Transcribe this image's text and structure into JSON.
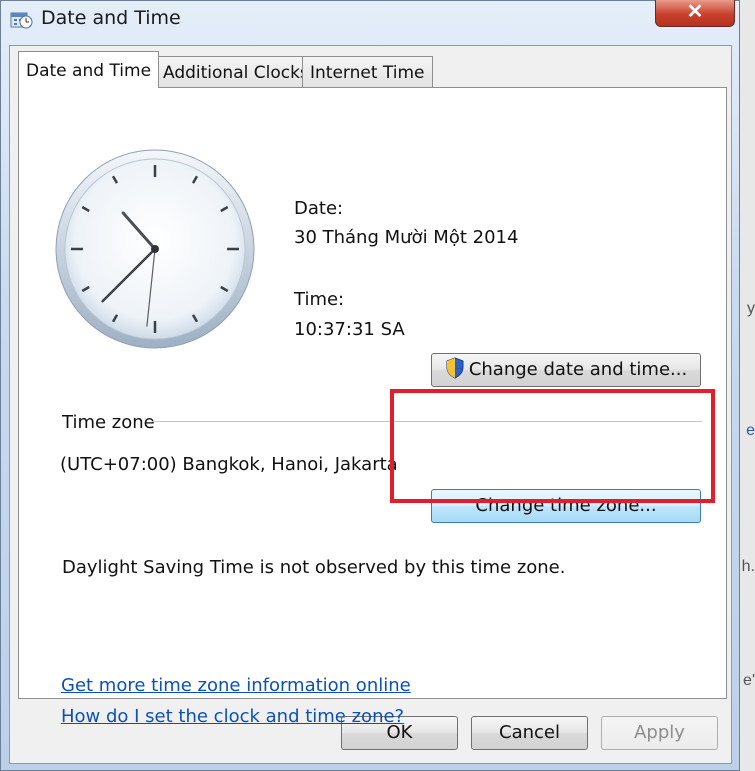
{
  "window": {
    "title": "Date and Time",
    "close_label": "✕"
  },
  "tabs": [
    {
      "label": "Date and Time",
      "active": true
    },
    {
      "label": "Additional Clocks",
      "active": false
    },
    {
      "label": "Internet Time",
      "active": false
    }
  ],
  "clock": {
    "hour": 10,
    "minute": 37,
    "second": 31
  },
  "date": {
    "label": "Date:",
    "value": "30 Tháng Mười Một 2014"
  },
  "time": {
    "label": "Time:",
    "value": "10:37:31 SA"
  },
  "change_datetime_button": "Change date and time...",
  "timezone": {
    "section_label": "Time zone",
    "value": "(UTC+07:00) Bangkok, Hanoi, Jakarta",
    "change_button": "Change time zone...",
    "dst_note": "Daylight Saving Time is not observed by this time zone."
  },
  "links": {
    "more_info": "Get more time zone information online",
    "how_to": "How do I set the clock and time zone?"
  },
  "footer": {
    "ok": "OK",
    "cancel": "Cancel",
    "apply": "Apply"
  },
  "background_fragments": [
    "y",
    "e",
    "h.",
    "e'"
  ],
  "colors": {
    "highlight": "#e01e2c",
    "link": "#0b50b8",
    "close": "#c8412c"
  }
}
